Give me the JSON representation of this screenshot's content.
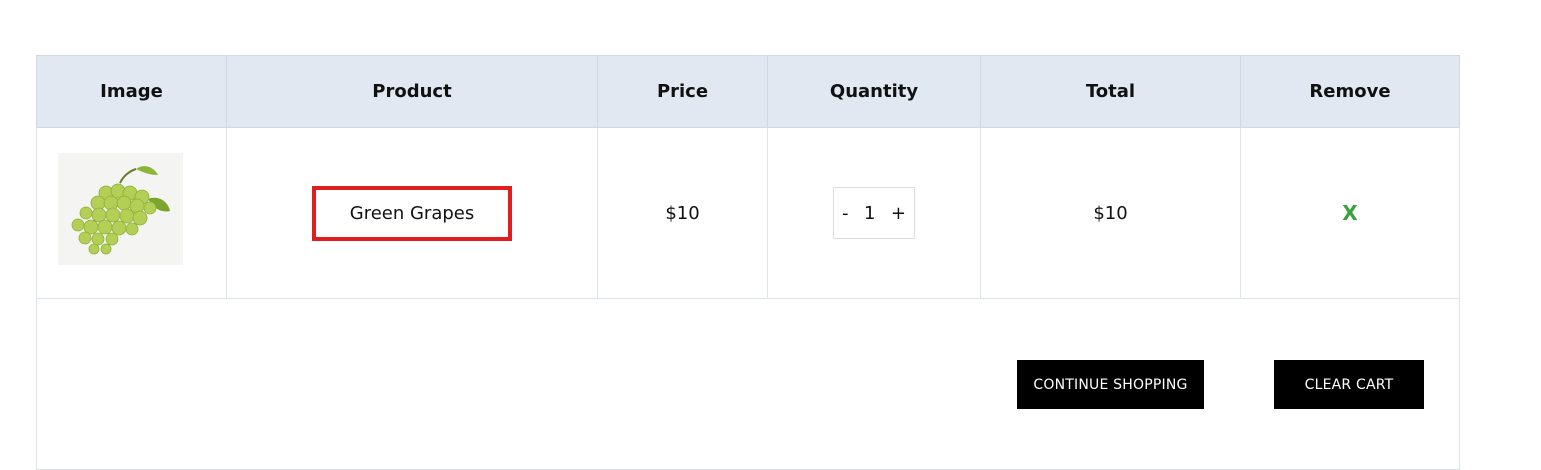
{
  "table": {
    "headers": [
      "Image",
      "Product",
      "Price",
      "Quantity",
      "Total",
      "Remove"
    ],
    "rows": [
      {
        "image_alt": "green-grapes-image",
        "product": "Green Grapes",
        "price": "$10",
        "quantity": "1",
        "total": "$10",
        "remove": "X"
      }
    ],
    "qty_minus": "-",
    "qty_plus": "+"
  },
  "actions": {
    "continue_label": "CONTINUE SHOPPING",
    "clear_label": "CLEAR CART"
  },
  "colors": {
    "header_bg": "#e1e8f1",
    "highlight_border": "#e01e1e",
    "remove_color": "#3aa23a",
    "button_bg": "#000000"
  }
}
